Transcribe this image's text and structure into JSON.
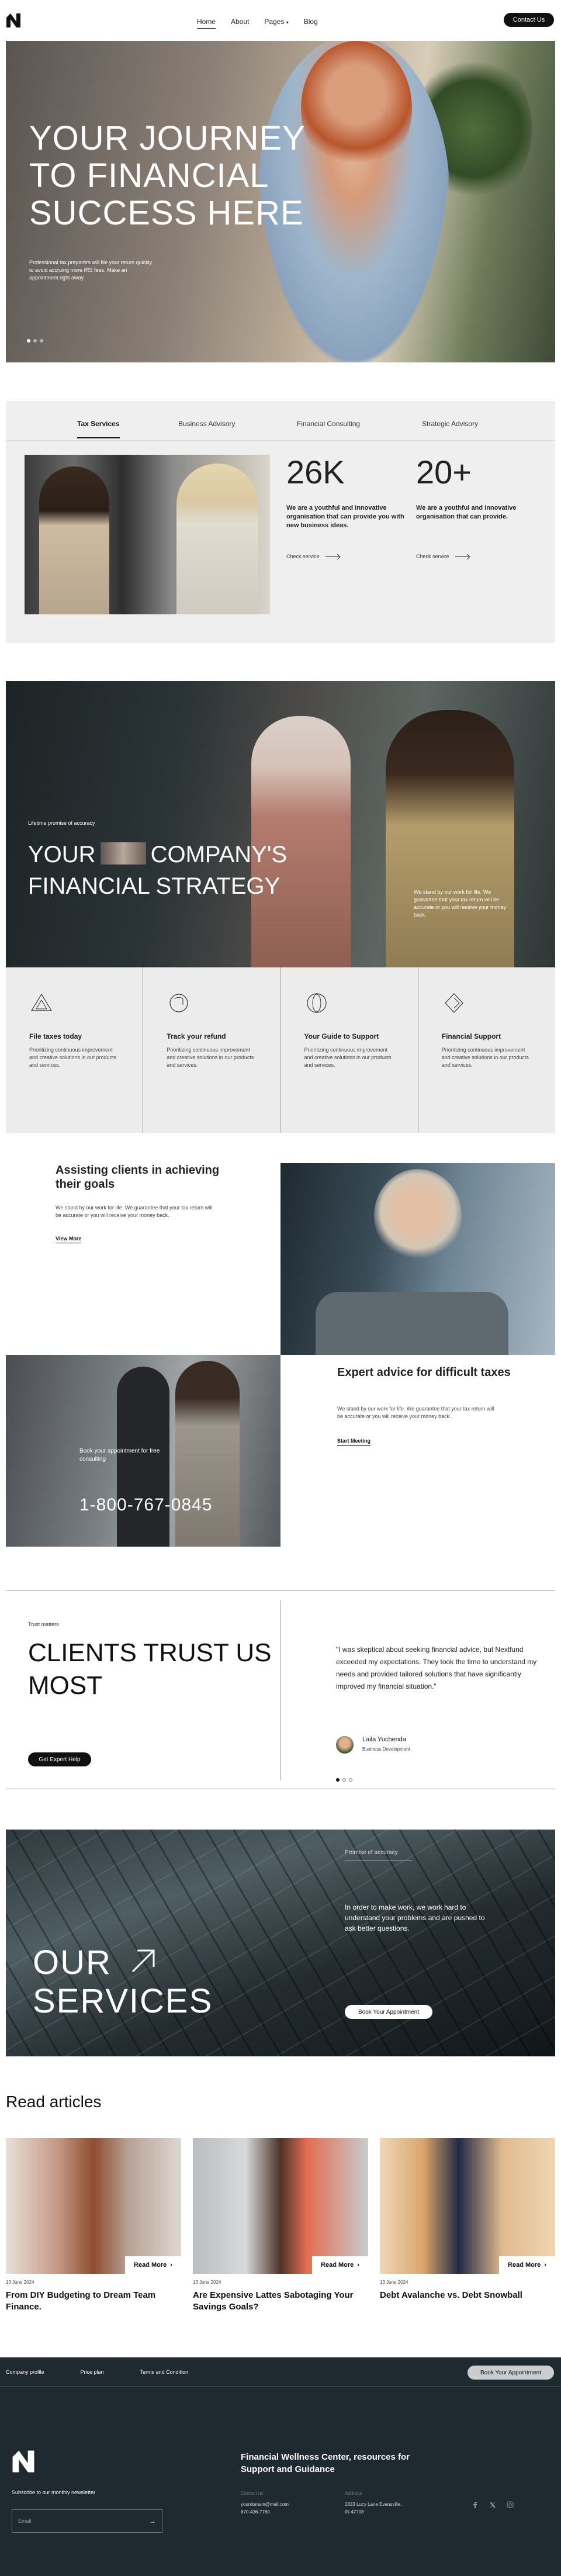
{
  "nav": {
    "items": [
      "Home",
      "About",
      "Pages",
      "Blog"
    ],
    "active": "Home",
    "pages_has_dropdown": true,
    "contact_label": "Contact Us"
  },
  "hero": {
    "title_lines": [
      "YOUR JOURNEY",
      "TO FINANCIAL",
      "SUCCESS HERE"
    ],
    "subtitle": "Professional tax preparers will file your return quickly to avoid accruing more IRS fees. Make an appointment right away.",
    "slides": 3,
    "active_slide": 1
  },
  "services": {
    "tabs": [
      "Tax Services",
      "Business Advisory",
      "Financial Consulting",
      "Strategic Advisory"
    ],
    "active_tab": "Tax Services",
    "stats": [
      {
        "value": "26K",
        "text": "We are a youthful and innovative organisation that can provide you with new business ideas.",
        "link": "Check service"
      },
      {
        "value": "20+",
        "text": "We are a youthful and innovative organisation that can provide.",
        "link": "Check service"
      }
    ]
  },
  "strategy": {
    "eyebrow": "Lifetime promise of accuracy",
    "title_line1_a": "YOUR",
    "title_line1_b": "COMPANY'S",
    "title_line2": "FINANCIAL STRATEGY",
    "note": "We stand by our work for life. We guarantee that your tax return will be accurate or you will receive your money back."
  },
  "features": [
    {
      "icon": "triangle-icon",
      "title": "File taxes today",
      "text": "Prioritizing continuous improvement and creative solutions in our products and services."
    },
    {
      "icon": "circle-refund-icon",
      "title": "Track your refund",
      "text": "Prioritizing continuous improvement and creative solutions in our products and services."
    },
    {
      "icon": "double-circle-icon",
      "title": "Your Guide to Support",
      "text": "Prioritizing continuous improvement and creative solutions in our products and services."
    },
    {
      "icon": "diamond-icon",
      "title": "Financial Support",
      "text": "Prioritizing continuous improvement and creative solutions in our products and services."
    }
  ],
  "assist": {
    "title": "Assisting clients in achieving their goals",
    "text": "We stand by our work for life. We guarantee that your tax return will be accurate or you will receive your money back.",
    "link": "View More"
  },
  "expert": {
    "book_text": "Book your appointment for free consulting",
    "phone": "1-800-767-0845",
    "title": "Expert advice for difficult taxes",
    "text": "We stand by our work for life. We guarantee that your tax return will be accurate or you will receive your money back.",
    "link": "Start Meeting"
  },
  "testimonial": {
    "eyebrow": "Trust matters",
    "title": "CLIENTS TRUST US MOST",
    "button": "Get Expert Help",
    "quote": "\"I was skeptical about seeking financial advice, but Nextfund exceeded my expectations. They took the time to understand my needs and provided tailored solutions that have significantly improved my financial situation.\"",
    "author": "Laila Yuchenda",
    "role": "Business Development",
    "slides": 3,
    "active_slide": 1
  },
  "our_services": {
    "title_line1": "OUR",
    "title_line2": "SERVICES",
    "tag": "Promise of accuracy",
    "description": "In order to make work, we work hard to understand your problems and are pushed to ask better questions.",
    "button": "Book Your Appointment"
  },
  "articles": {
    "heading": "Read articles",
    "items": [
      {
        "date": "13 June 2024",
        "title": "From DIY Budgeting to Dream Team Finance.",
        "read_more": "Read More"
      },
      {
        "date": "13 June 2024",
        "title": "Are Expensive Lattes Sabotaging Your Savings Goals?",
        "read_more": "Read More"
      },
      {
        "date": "13 June 2024",
        "title": "Debt Avalanche vs. Debt Snowball",
        "read_more": "Read More"
      }
    ]
  },
  "footer": {
    "links": [
      "Company profile",
      "Price plan",
      "Terms and Condition"
    ],
    "book": "Book Your Appointment",
    "newsletter_label": "Subscribe to our monthly newsletter",
    "email_placeholder": "Email",
    "headline": "Financial Wellness Center, resources for Support and Guidance",
    "contact_label": "Contact us",
    "contact_email": "yourdomain@mail.com",
    "contact_phone": "870-436-7780",
    "address_label": "Address",
    "address_line1": "2833 Lucy Lane Evansville,",
    "address_line2": "IN 47708",
    "social": [
      "facebook-icon",
      "twitter-icon",
      "instagram-icon"
    ]
  }
}
